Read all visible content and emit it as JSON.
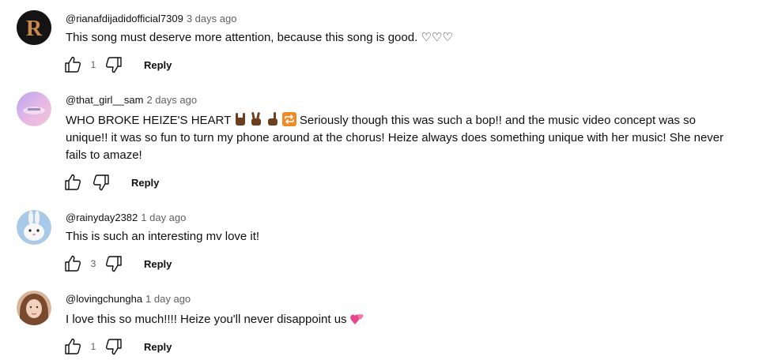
{
  "icons": {
    "like": "thumbs-up-icon",
    "dislike": "thumbs-down-icon"
  },
  "comments": [
    {
      "handle": "@rianafdijadidofficial7309",
      "time": "3 days ago",
      "text": "This song must deserve more attention, because this song is good. ♡♡♡",
      "likes": "1",
      "reply": "Reply"
    },
    {
      "handle": "@that_girl__sam",
      "time": "2 days ago",
      "text_start": "WHO BROKE HEIZE'S HEART",
      "text_end": " Seriously though this was such a bop!! and the music video concept was so unique!! it was so fun to turn my phone around at the chorus! Heize always does something unique with her music! She never fails to amaze!",
      "likes": "",
      "reply": "Reply"
    },
    {
      "handle": "@rainyday2382",
      "time": "1 day ago",
      "text": "This is such an interesting mv love it!",
      "likes": "3",
      "reply": "Reply"
    },
    {
      "handle": "@lovingchungha",
      "time": "1 day ago",
      "text": "I love this so much!!!! Heize you'll never disappoint us",
      "likes": "1",
      "reply": "Reply"
    }
  ]
}
